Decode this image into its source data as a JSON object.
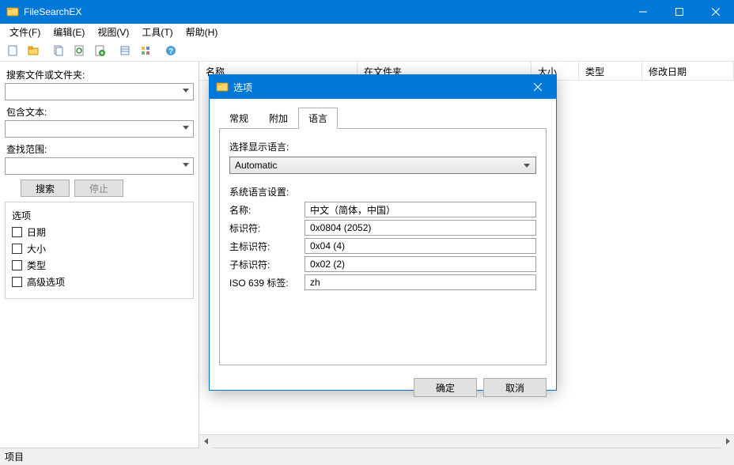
{
  "window": {
    "title": "FileSearchEX"
  },
  "menu": {
    "file": "文件(F)",
    "edit": "编辑(E)",
    "view": "视图(V)",
    "tools": "工具(T)",
    "help": "帮助(H)"
  },
  "leftpanel": {
    "search_label": "搜索文件或文件夹:",
    "contains_label": "包含文本:",
    "lookin_label": "查找范围:",
    "search_btn": "搜索",
    "stop_btn": "停止",
    "options_title": "选项",
    "opt_date": "日期",
    "opt_size": "大小",
    "opt_type": "类型",
    "opt_advanced": "高级选项"
  },
  "columns": {
    "name": "名称",
    "infolder": "在文件夹",
    "size": "大小",
    "type": "类型",
    "modified": "修改日期"
  },
  "dialog": {
    "title": "选项",
    "tabs": {
      "general": "常规",
      "additional": "附加",
      "language": "语言"
    },
    "lang_select_label": "选择显示语言:",
    "lang_value": "Automatic",
    "sys_lang_label": "系统语言设置:",
    "rows": {
      "name_k": "名称:",
      "name_v": "中文（简体，中国）",
      "id_k": "标识符:",
      "id_v": "0x0804    (2052)",
      "major_k": "主标识符:",
      "major_v": "0x04        (4)",
      "sub_k": "子标识符:",
      "sub_v": "0x02        (2)",
      "iso_k": "ISO 639 标签:",
      "iso_v": "zh"
    },
    "ok": "确定",
    "cancel": "取消"
  },
  "statusbar": {
    "text": "项目"
  }
}
